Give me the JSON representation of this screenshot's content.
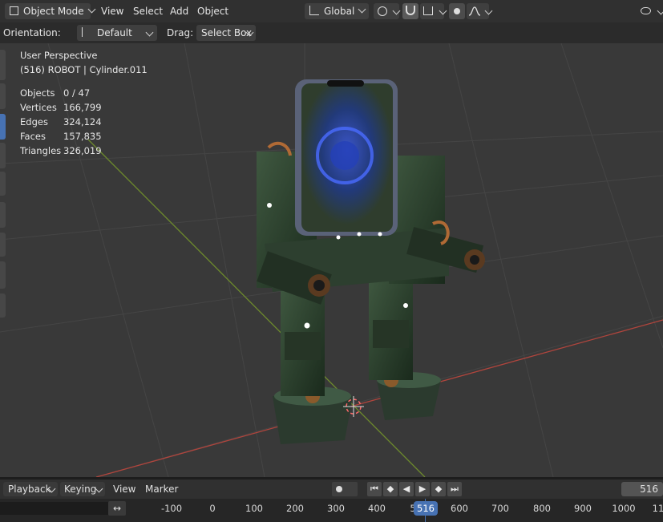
{
  "header": {
    "mode_label": "Object Mode",
    "menu": [
      "View",
      "Select",
      "Add",
      "Object"
    ],
    "transform_orientation": "Global",
    "orientation_label": "Orientation:",
    "orientation_value": "Default",
    "drag_label": "Drag:",
    "drag_value": "Select Box"
  },
  "overlay": {
    "view_name": "User Perspective",
    "object_info": "(516) ROBOT | Cylinder.011",
    "stats": [
      {
        "label": "Objects",
        "value": "0 / 47"
      },
      {
        "label": "Vertices",
        "value": "166,799"
      },
      {
        "label": "Edges",
        "value": "324,124"
      },
      {
        "label": "Faces",
        "value": "157,835"
      },
      {
        "label": "Triangles",
        "value": "326,019"
      }
    ]
  },
  "timeline": {
    "menu": [
      "Playback",
      "Keying",
      "View",
      "Marker"
    ],
    "current_frame": "516",
    "ruler_ticks": [
      "-100",
      "0",
      "100",
      "200",
      "300",
      "400",
      "5",
      "600",
      "700",
      "800",
      "900",
      "1000",
      "11"
    ],
    "playhead_label": "516"
  },
  "colors": {
    "x_axis": "#b0453d",
    "y_axis": "#6d8a2d",
    "playhead": "#4772b3"
  }
}
